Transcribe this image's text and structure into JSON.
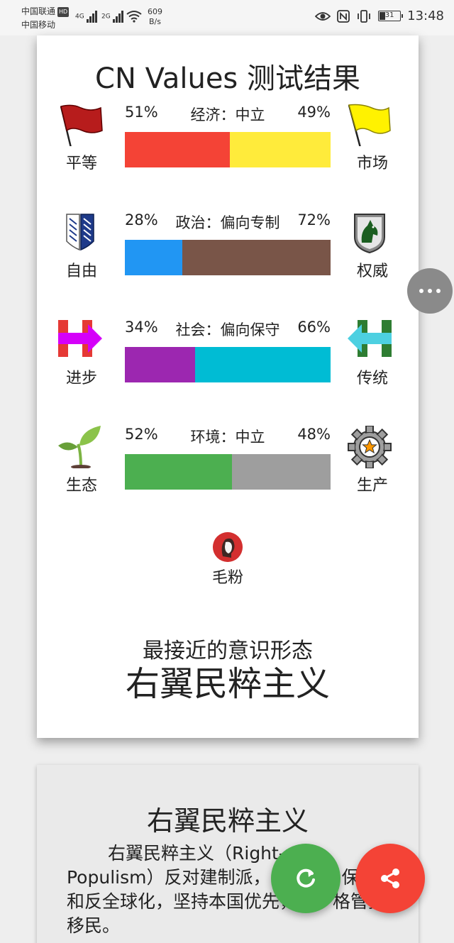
{
  "status_bar": {
    "carrier1": "中国联通",
    "carrier1_badge": "HD",
    "carrier2": "中国移动",
    "signal1": "4G",
    "signal2": "2G",
    "net_speed_value": "609",
    "net_speed_unit": "B/s",
    "battery": "31",
    "time": "13:48"
  },
  "card": {
    "title": "CN Values 测试结果",
    "axes": [
      {
        "left_label": "平等",
        "right_label": "市场",
        "left_pct": "51%",
        "right_pct": "49%",
        "axis_name": "经济：中立",
        "left_value": 51,
        "right_value": 49,
        "left_color": "#f44336",
        "right_color": "#ffeb3b",
        "left_icon": "red-flag-icon",
        "right_icon": "yellow-flag-icon"
      },
      {
        "left_label": "自由",
        "right_label": "权威",
        "left_pct": "28%",
        "right_pct": "72%",
        "axis_name": "政治：偏向专制",
        "left_value": 28,
        "right_value": 72,
        "left_color": "#2196f3",
        "right_color": "#795548",
        "left_icon": "wings-emblem-icon",
        "right_icon": "horse-shield-icon"
      },
      {
        "left_label": "进步",
        "right_label": "传统",
        "left_pct": "34%",
        "right_pct": "66%",
        "axis_name": "社会：偏向保守",
        "left_value": 34,
        "right_value": 66,
        "left_color": "#9c27b0",
        "right_color": "#00bcd4",
        "left_icon": "h-arrow-right-icon",
        "right_icon": "h-arrow-left-icon"
      },
      {
        "left_label": "生态",
        "right_label": "生产",
        "left_pct": "52%",
        "right_pct": "48%",
        "axis_name": "环境：中立",
        "left_value": 52,
        "right_value": 48,
        "left_color": "#4caf50",
        "right_color": "#9e9e9e",
        "left_icon": "sprout-icon",
        "right_icon": "gear-star-icon"
      }
    ],
    "badge_label": "毛粉",
    "closest_label": "最接近的意识形态",
    "closest_value": "右翼民粹主义"
  },
  "card2": {
    "title": "右翼民粹主义",
    "body": "右翼民粹主义（Right-wing Populism）反对建制派，主张贸易保护和反全球化，坚持本国优先，并严格管控移民。"
  }
}
